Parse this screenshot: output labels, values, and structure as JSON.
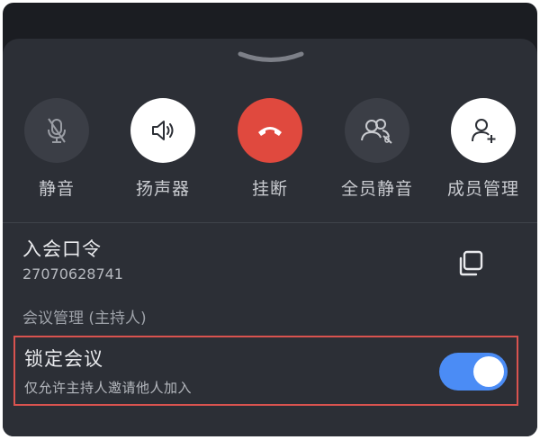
{
  "actions": [
    {
      "label": "静音",
      "icon": "mic-muted-icon"
    },
    {
      "label": "扬声器",
      "icon": "speaker-icon"
    },
    {
      "label": "挂断",
      "icon": "hang-up-icon"
    },
    {
      "label": "全员静音",
      "icon": "mute-all-icon"
    },
    {
      "label": "成员管理",
      "icon": "add-member-icon"
    }
  ],
  "meeting_code": {
    "title": "入会口令",
    "value": "27070628741",
    "copy_icon": "copy-icon"
  },
  "section": {
    "label": "会议管理 (主持人)"
  },
  "lock_meeting": {
    "title": "锁定会议",
    "description": "仅允许主持人邀请他人加入",
    "enabled": true
  },
  "colors": {
    "panel": "#2c2f36",
    "hang_up": "#e0493e",
    "toggle_on": "#4b8cf5",
    "highlight_border": "#d9534f"
  }
}
